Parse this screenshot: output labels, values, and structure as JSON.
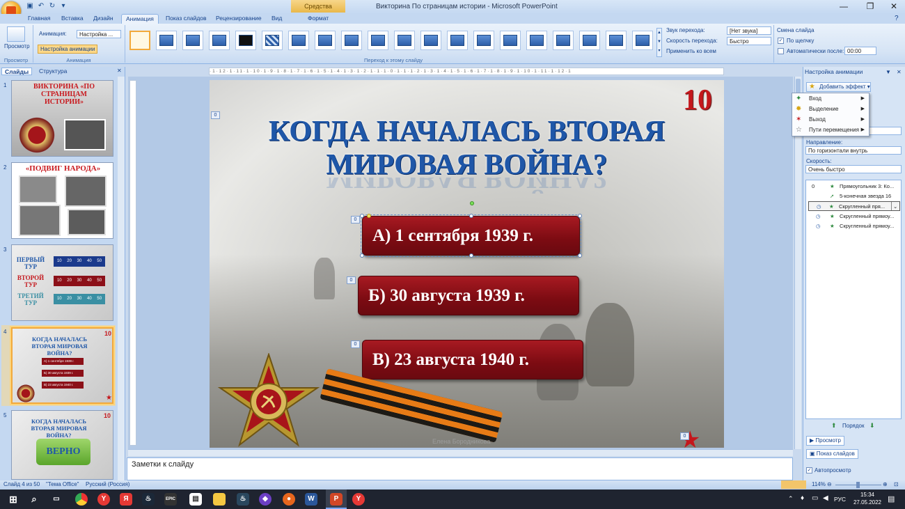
{
  "window": {
    "title": "Викторина По страницам истории - Microsoft PowerPoint",
    "context_tab": "Средства рисования",
    "minimize": "—",
    "maximize": "❐",
    "close": "✕"
  },
  "tabs": [
    "Главная",
    "Вставка",
    "Дизайн",
    "Анимация",
    "Показ слайдов",
    "Рецензирование",
    "Вид",
    "Формат"
  ],
  "active_tab": "Анимация",
  "ribbon": {
    "preview_label": "Просмотр",
    "animation_label": "Анимация:",
    "animation_value": "Настройка ...",
    "custom_animation_label": "Настройка анимации",
    "group_preview": "Просмотр",
    "group_animation": "Анимация",
    "group_transition": "Переход к этому слайду",
    "sound_label": "Звук перехода:",
    "sound_value": "[Нет звука]",
    "speed_label": "Скорость перехода:",
    "speed_value": "Быстро",
    "apply_all": "Применить ко всем",
    "advance_label": "Смена слайда",
    "on_click": "По щелчку",
    "auto_after": "Автоматически после:",
    "auto_time": "00:00"
  },
  "left_pane": {
    "tab_slides": "Слайды",
    "tab_outline": "Структура",
    "close": "✕",
    "thumbnails": [
      {
        "num": "1",
        "title": "ВИКТОРИНА «ПО СТРАНИЦАМ ИСТОРИИ»"
      },
      {
        "num": "2",
        "title": "«ПОДВИГ НАРОДА»"
      },
      {
        "num": "3",
        "rows": [
          {
            "label": "ПЕРВЫЙ ТУР",
            "cells": [
              "10",
              "20",
              "30",
              "40",
              "50"
            ]
          },
          {
            "label": "ВТОРОЙ ТУР",
            "cells": [
              "10",
              "20",
              "30",
              "40",
              "50"
            ]
          },
          {
            "label": "ТРЕТИЙ ТУР",
            "cells": [
              "10",
              "20",
              "30",
              "40",
              "50"
            ]
          }
        ]
      },
      {
        "num": "4",
        "title": "КОГДА НАЧАЛАСЬ ВТОРАЯ МИРОВАЯ ВОЙНА?",
        "points": "10",
        "answers": [
          "А)  1 сентября 1939 г.",
          "Б)  30 августа 1939 г.",
          "В)  23 августа 1940 г."
        ]
      },
      {
        "num": "5",
        "title": "КОГДА НАЧАЛАСЬ ВТОРАЯ МИРОВАЯ ВОЙНА?",
        "points": "10",
        "button": "ВЕРНО"
      }
    ]
  },
  "ruler_text": "·1·12·1·11·1·10·1·9·1·8·1·7·1·6·1·5·1·4·1·3·1·2·1·1·1·0·1·1·1·2·1·3·1·4·1·5·1·6·1·7·1·8·1·9·1·10·1·11·1·12·1",
  "slide": {
    "title_line1": "КОГДА НАЧАЛАСЬ ВТОРАЯ",
    "title_line2": "МИРОВАЯ ВОЙНА?",
    "points": "10",
    "answers": [
      "А)   1 сентября 1939 г.",
      "Б)    30 августа 1939 г.",
      "В)    23 августа 1940 г."
    ],
    "anim_tag": "0",
    "author": "Елена Бородникова"
  },
  "notes_placeholder": "Заметки к слайду",
  "status": {
    "slide": "Слайд 4 из 50",
    "theme": "\"Тема Office\"",
    "lang": "Русский (Россия)",
    "zoom": "114%"
  },
  "task_pane": {
    "title": "Настройка анимации",
    "add_effect": "Добавить эффект",
    "menu": [
      "Вход",
      "Выделение",
      "Выход",
      "Пути перемещения"
    ],
    "direction_label": "Направление:",
    "direction_value": "По горизонтали внутрь",
    "speed_label": "Скорость:",
    "speed_value": "Очень быстро",
    "list": [
      {
        "idx": "0",
        "text": "Прямоугольник 3: Ко..."
      },
      {
        "idx": "",
        "text": "5-конечная звезда 16"
      },
      {
        "idx": "",
        "text": "Скругленный пря..."
      },
      {
        "idx": "",
        "text": "Скругленный прямоу..."
      },
      {
        "idx": "",
        "text": "Скругленный прямоу..."
      }
    ],
    "order_label": "Порядок",
    "preview_btn": "Просмотр",
    "slideshow_btn": "Показ слайдов",
    "autopreview": "Автопросмотр"
  },
  "taskbar": {
    "lang": "РУС",
    "time": "15:34",
    "date": "27.05.2022"
  }
}
